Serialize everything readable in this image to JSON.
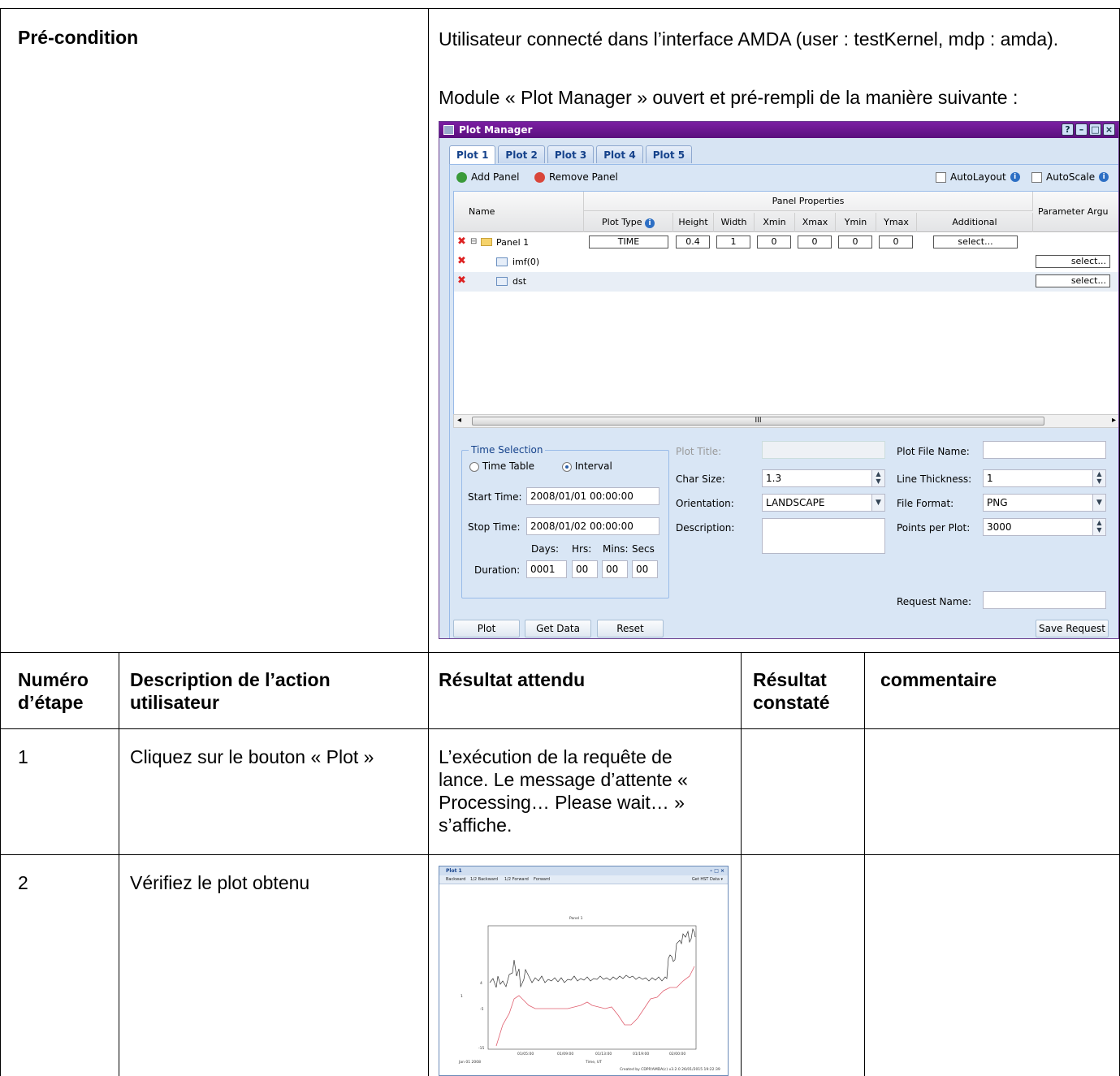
{
  "precondition": {
    "label": "Pré-condition",
    "line1": "Utilisateur connecté dans l’interface AMDA (user : testKernel, mdp : amda).",
    "line2": "Module « Plot Manager » ouvert et pré-rempli de la manière suivante :"
  },
  "plot_manager": {
    "title": "Plot Manager",
    "tabs": [
      "Plot 1",
      "Plot 2",
      "Plot 3",
      "Plot 4",
      "Plot 5"
    ],
    "active_tab": "Plot 1",
    "toolbar": {
      "add_panel": "Add Panel",
      "remove_panel": "Remove Panel",
      "autolayout": "AutoLayout",
      "autoscale": "AutoScale"
    },
    "grid": {
      "col_name": "Name",
      "group_header": "Panel Properties",
      "columns": [
        "Plot Type",
        "Height",
        "Width",
        "Xmin",
        "Xmax",
        "Ymin",
        "Ymax",
        "Additional"
      ],
      "col_param": "Parameter Argu",
      "rows": [
        {
          "name": "Panel 1",
          "plot_type": "TIME",
          "height": "0.4",
          "width": "1",
          "xmin": "0",
          "xmax": "0",
          "ymin": "0",
          "ymax": "0",
          "additional": "select..."
        },
        {
          "name": "imf(0)",
          "param": "select..."
        },
        {
          "name": "dst",
          "param": "select..."
        }
      ],
      "scroll_mark": "III"
    },
    "time_selection": {
      "legend": "Time Selection",
      "opt_table": "Time Table",
      "opt_interval": "Interval",
      "start_label": "Start Time:",
      "start_value": "2008/01/01 00:00:00",
      "stop_label": "Stop Time:",
      "stop_value": "2008/01/02 00:00:00",
      "days": "Days:",
      "hrs": "Hrs:",
      "mins": "Mins:",
      "secs": "Secs",
      "duration_label": "Duration:",
      "dur_days": "0001",
      "dur_hrs": "00",
      "dur_mins": "00",
      "dur_secs": "00"
    },
    "options": {
      "plot_title_label": "Plot Title:",
      "char_size_label": "Char Size:",
      "char_size": "1.3",
      "orientation_label": "Orientation:",
      "orientation": "LANDSCAPE",
      "description_label": "Description:",
      "file_name_label": "Plot File Name:",
      "line_thickness_label": "Line Thickness:",
      "line_thickness": "1",
      "file_format_label": "File Format:",
      "file_format": "PNG",
      "points_label": "Points per Plot:",
      "points": "3000",
      "request_name_label": "Request Name:"
    },
    "buttons": {
      "plot": "Plot",
      "get_data": "Get Data",
      "reset": "Reset",
      "save_request": "Save Request"
    }
  },
  "table": {
    "headers": [
      "Numéro d’étape",
      "Description de l’action utilisateur",
      "Résultat attendu",
      "Résultat constaté",
      "commentaire"
    ],
    "rows": [
      {
        "num": "1",
        "action": "Cliquez sur le bouton « Plot »",
        "expected": "L’exécution de la requête de lance. Le message d’attente « Processing… Please wait… » s’affiche."
      },
      {
        "num": "2",
        "action": "Vérifiez le plot obtenu"
      }
    ]
  },
  "plot_preview": {
    "title": "Plot 1",
    "toolbar": [
      "Backward",
      "1/2 Backward",
      "1/2 Forward",
      "Forward"
    ],
    "hst": "Get HST Data ▾",
    "panel_title": "Panel 1",
    "xticks": [
      "01/05:00",
      "01/09:00",
      "01/13:00",
      "01/19:00",
      "02/00:00"
    ],
    "start_label": "Jan 01 2008",
    "xlabel": "Time, UT",
    "yticks": [
      "4",
      "-5",
      "-15"
    ],
    "yaxis_mark": "1",
    "footer": "Created by CDPP/AMDA(c) v3.2.0 26/01/2015 19:22:39"
  }
}
